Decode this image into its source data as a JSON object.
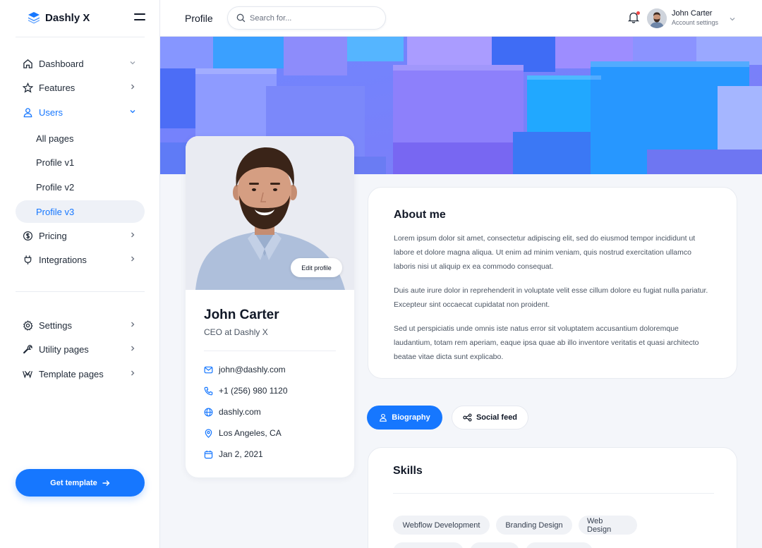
{
  "brand": {
    "name": "Dashly X"
  },
  "sidebar": {
    "items": [
      {
        "label": "Dashboard"
      },
      {
        "label": "Features"
      },
      {
        "label": "Users"
      },
      {
        "label": "Pricing"
      },
      {
        "label": "Integrations"
      },
      {
        "label": "Settings"
      },
      {
        "label": "Utility pages"
      },
      {
        "label": "Template pages"
      }
    ],
    "users_subitems": [
      "All pages",
      "Profile v1",
      "Profile v2",
      "Profile v3"
    ],
    "cta_label": "Get template"
  },
  "header": {
    "title": "Profile",
    "search_placeholder": "Search for...",
    "user_name": "John Carter",
    "user_sub": "Account settings"
  },
  "profile": {
    "edit_label": "Edit profile",
    "name": "John Carter",
    "role": "CEO at Dashly X",
    "email": "john@dashly.com",
    "phone": "+1 (256) 980 1120",
    "website": "dashly.com",
    "location": "Los Angeles, CA",
    "date": "Jan 2, 2021"
  },
  "about": {
    "title": "About me",
    "paragraphs": [
      "Lorem ipsum dolor sit amet, consectetur adipiscing elit, sed do eiusmod tempor incididunt ut labore et dolore magna aliqua. Ut enim ad minim veniam, quis nostrud exercitation ullamco laboris nisi ut aliquip ex ea commodo consequat.",
      "Duis aute irure dolor in reprehenderit in voluptate velit esse cillum dolore eu fugiat nulla pariatur. Excepteur sint occaecat cupidatat non proident.",
      "Sed ut perspiciatis unde omnis iste natus error sit voluptatem accusantium doloremque laudantium, totam rem aperiam, eaque ipsa quae ab illo inventore veritatis et quasi architecto beatae vitae dicta sunt explicabo."
    ]
  },
  "tabs": [
    {
      "label": "Biography",
      "active": true
    },
    {
      "label": "Social feed",
      "active": false
    }
  ],
  "skills": {
    "title": "Skills",
    "chips": [
      "Webflow Development",
      "Branding Design",
      "Web Design"
    ]
  },
  "colors": {
    "accent": "#1677ff",
    "notification_dot": "#ef4444"
  },
  "icons": {
    "brand": "layers-icon",
    "bell": "bell-icon",
    "search": "search-icon"
  }
}
